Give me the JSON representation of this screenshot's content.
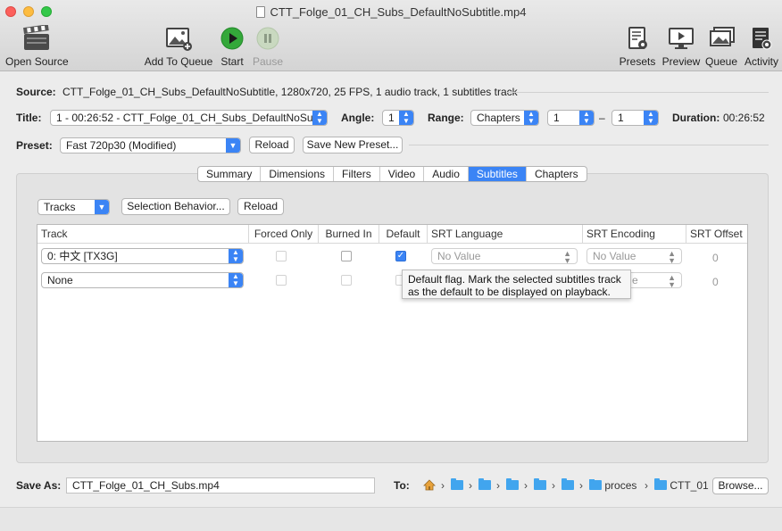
{
  "window": {
    "title": "CTT_Folge_01_CH_Subs_DefaultNoSubtitle.mp4"
  },
  "toolbar": {
    "open_source": "Open Source",
    "add_to_queue": "Add To Queue",
    "start": "Start",
    "pause": "Pause",
    "presets": "Presets",
    "preview": "Preview",
    "queue": "Queue",
    "activity": "Activity"
  },
  "source": {
    "label": "Source:",
    "value": "CTT_Folge_01_CH_Subs_DefaultNoSubtitle, 1280x720, 25 FPS, 1 audio track, 1 subtitles track"
  },
  "title_row": {
    "title_label": "Title:",
    "title_value": "1 - 00:26:52 - CTT_Folge_01_CH_Subs_DefaultNoSubtitle",
    "angle_label": "Angle:",
    "angle_value": "1",
    "range_label": "Range:",
    "range_type": "Chapters",
    "range_start": "1",
    "range_dash": "–",
    "range_end": "1",
    "duration_label": "Duration:",
    "duration_value": "00:26:52"
  },
  "preset_row": {
    "label": "Preset:",
    "value": "Fast 720p30 (Modified)",
    "reload": "Reload",
    "save_new": "Save New Preset..."
  },
  "tabs": [
    "Summary",
    "Dimensions",
    "Filters",
    "Video",
    "Audio",
    "Subtitles",
    "Chapters"
  ],
  "active_tab": "Subtitles",
  "subtitles": {
    "tracks_popup": "Tracks",
    "selection_behavior": "Selection Behavior...",
    "reload": "Reload",
    "columns": [
      "Track",
      "Forced Only",
      "Burned In",
      "Default",
      "SRT Language",
      "SRT Encoding",
      "SRT Offset"
    ],
    "rows": [
      {
        "track": "0: 中文 [TX3G]",
        "forced": false,
        "burned": false,
        "default": true,
        "srt_language": "No Value",
        "srt_encoding": "No Value",
        "srt_offset": "0"
      },
      {
        "track": "None",
        "forced": false,
        "burned": false,
        "default": false,
        "srt_language": "",
        "srt_encoding": "e",
        "srt_offset": "0"
      }
    ],
    "tooltip_line1": "Default flag. Mark the selected subtitles track",
    "tooltip_line2": "as the default to be displayed on playback."
  },
  "save": {
    "label": "Save As:",
    "filename": "CTT_Folge_01_CH_Subs.mp4",
    "to_label": "To:",
    "path_folder1": "proces",
    "path_folder2": "CTT_01",
    "browse": "Browse..."
  },
  "icons": {
    "open_source": "clapperboard-icon",
    "add_to_queue": "photos-add-icon",
    "start": "play-icon",
    "pause": "pause-icon",
    "presets": "document-gear-icon",
    "preview": "monitor-play-icon",
    "queue": "photo-stack-icon",
    "activity": "log-gear-icon",
    "home": "home-icon",
    "folder": "folder-icon"
  },
  "colors": {
    "accent": "#3b84f5",
    "start_green": "#34a83a",
    "close": "#fc605c",
    "minimize": "#fdbc40",
    "maximize": "#34c84a"
  }
}
